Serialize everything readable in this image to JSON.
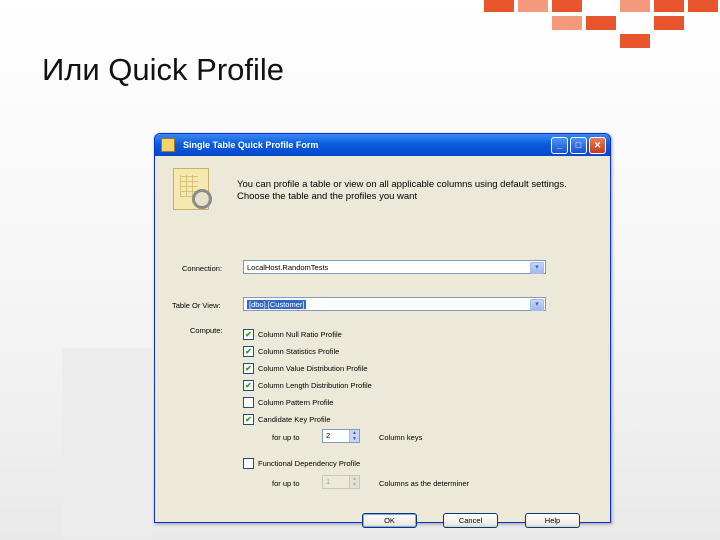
{
  "slide": {
    "title": "Или Quick Profile"
  },
  "window": {
    "title": "Single Table Quick Profile Form",
    "controls": {
      "minimize": "_",
      "maximize": "□",
      "close": "✕"
    }
  },
  "intro": "You can profile a table or view on all applicable columns using default settings. Choose the table and the profiles you want",
  "connection": {
    "label": "Connection:",
    "value": "LocalHost.RandomTests"
  },
  "table": {
    "label": "Table Or View:",
    "value": "[dbo].[Customer]"
  },
  "compute": {
    "label": "Compute:",
    "profiles": [
      {
        "label": "Column Null Ratio Profile",
        "checked": true
      },
      {
        "label": "Column Statistics Profile",
        "checked": true
      },
      {
        "label": "Column Value Distribution Profile",
        "checked": true
      },
      {
        "label": "Column Length Distribution Profile",
        "checked": true
      },
      {
        "label": "Column Pattern Profile",
        "checked": false
      },
      {
        "label": "Candidate Key Profile",
        "checked": true
      }
    ],
    "candidate_key": {
      "prefix": "for up to",
      "value": "2",
      "suffix": "Column keys"
    },
    "functional": {
      "label": "Functional Dependency Profile",
      "checked": false
    },
    "functional_detail": {
      "prefix": "for up to",
      "value": "1",
      "suffix": "Columns as the determiner"
    }
  },
  "buttons": {
    "ok": "OK",
    "cancel": "Cancel",
    "help": "Help"
  },
  "icons": {
    "check": "✔",
    "dropdown": "▾",
    "spin_up": "▲",
    "spin_down": "▼"
  }
}
